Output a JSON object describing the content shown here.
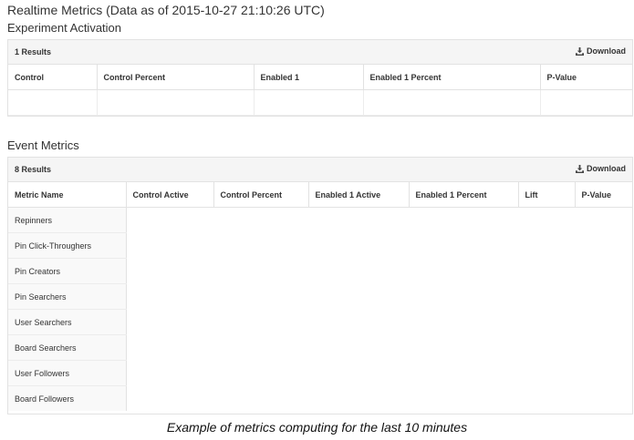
{
  "page": {
    "title": "Realtime Metrics (Data as of 2015-10-27 21:10:26 UTC)"
  },
  "experiment_activation": {
    "title": "Experiment Activation",
    "results": "1 Results",
    "download_label": "Download",
    "columns": [
      "Control",
      "Control Percent",
      "Enabled 1",
      "Enabled 1 Percent",
      "P-Value"
    ]
  },
  "event_metrics": {
    "title": "Event Metrics",
    "results": "8 Results",
    "download_label": "Download",
    "columns": [
      "Metric Name",
      "Control Active",
      "Control Percent",
      "Enabled 1 Active",
      "Enabled 1 Percent",
      "Lift",
      "P-Value"
    ],
    "rows": [
      "Repinners",
      "Pin Click-Throughers",
      "Pin Creators",
      "Pin Searchers",
      "User Searchers",
      "Board Searchers",
      "User Followers",
      "Board Followers"
    ]
  },
  "caption": "Example of metrics computing for the last 10 minutes",
  "icons": {
    "download": "download-icon"
  }
}
